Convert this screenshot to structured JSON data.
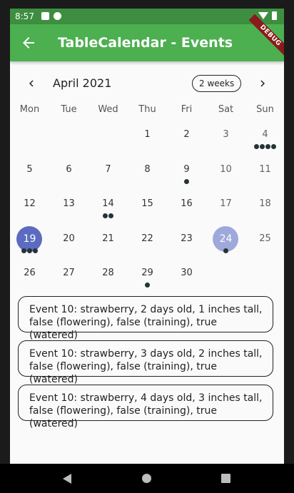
{
  "status_bar": {
    "time": "8:57",
    "debug_label": "DEBUG"
  },
  "app_bar": {
    "title": "TableCalendar - Events",
    "back_icon": "arrow-back-icon"
  },
  "calendar": {
    "month_title": "April 2021",
    "format_button": "2 weeks",
    "days_of_week": [
      "Mon",
      "Tue",
      "Wed",
      "Thu",
      "Fri",
      "Sat",
      "Sun"
    ],
    "weeks": [
      [
        {
          "day": ""
        },
        {
          "day": ""
        },
        {
          "day": ""
        },
        {
          "day": "1"
        },
        {
          "day": "2"
        },
        {
          "day": "3",
          "weekend": true
        },
        {
          "day": "4",
          "weekend": true,
          "events": 4
        }
      ],
      [
        {
          "day": "5"
        },
        {
          "day": "6"
        },
        {
          "day": "7"
        },
        {
          "day": "8"
        },
        {
          "day": "9",
          "events": 1
        },
        {
          "day": "10",
          "weekend": true
        },
        {
          "day": "11",
          "weekend": true
        }
      ],
      [
        {
          "day": "12"
        },
        {
          "day": "13"
        },
        {
          "day": "14",
          "events": 2
        },
        {
          "day": "15"
        },
        {
          "day": "16"
        },
        {
          "day": "17",
          "weekend": true
        },
        {
          "day": "18",
          "weekend": true
        }
      ],
      [
        {
          "day": "19",
          "selected": true,
          "events": 3
        },
        {
          "day": "20"
        },
        {
          "day": "21"
        },
        {
          "day": "22"
        },
        {
          "day": "23"
        },
        {
          "day": "24",
          "today": true,
          "weekend": true,
          "events": 1
        },
        {
          "day": "25",
          "weekend": true
        }
      ],
      [
        {
          "day": "26"
        },
        {
          "day": "27"
        },
        {
          "day": "28"
        },
        {
          "day": "29",
          "events": 1
        },
        {
          "day": "30"
        },
        {
          "day": ""
        },
        {
          "day": ""
        }
      ]
    ]
  },
  "events": [
    {
      "text": "Event 10: strawberry, 2 days old, 1 inches tall, false (flowering), false (training), true (watered)"
    },
    {
      "text": "Event 10: strawberry, 3 days old, 2 inches tall, false (flowering), false (training), true (watered)"
    },
    {
      "text": "Event 10: strawberry, 4 days old, 3 inches tall, false (flowering), false (training), true (watered)"
    }
  ],
  "colors": {
    "app_bar": "#4caf50",
    "status_bar": "#3e8e41",
    "selected_day": "#5c6bc0",
    "today": "#9fa8da",
    "event_marker": "#263238"
  }
}
